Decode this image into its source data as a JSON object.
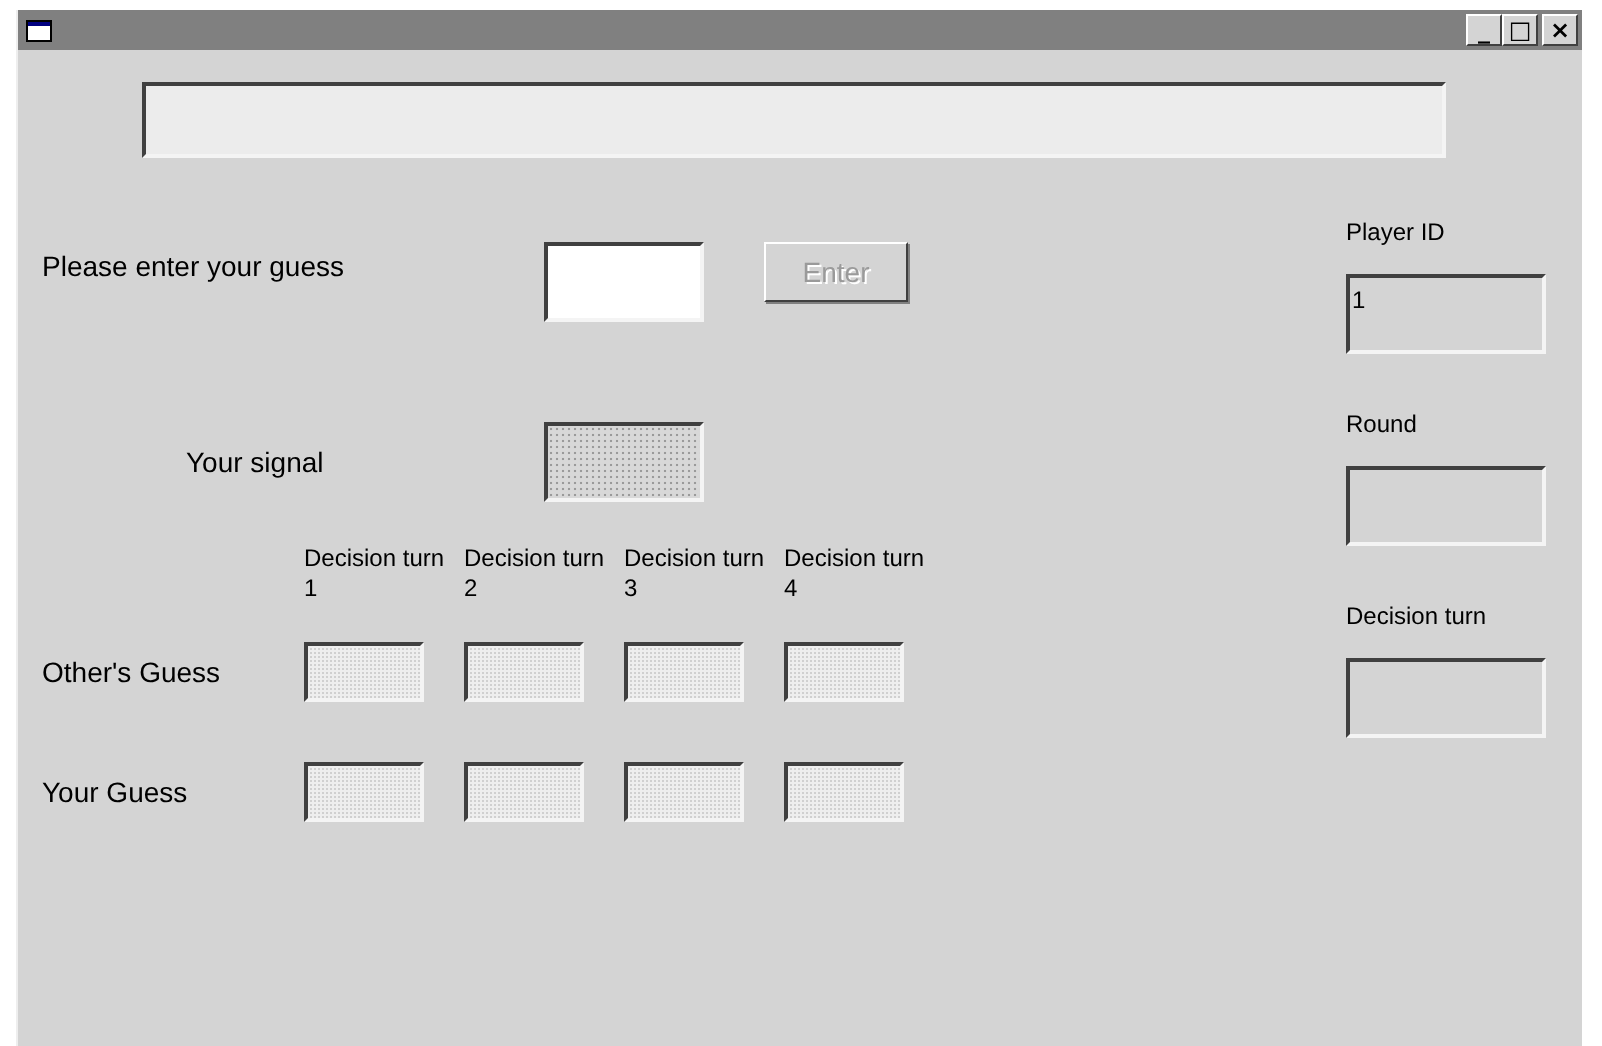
{
  "window": {
    "controls": [
      "_",
      "□",
      "×"
    ]
  },
  "status_display": {
    "disabled": true
  },
  "guess_prompt": {
    "label": "Please enter your guess",
    "disabled": false
  },
  "enter_button": {
    "label": "Enter",
    "disabled": true
  },
  "signal": {
    "label": "Your signal",
    "disabled": true
  },
  "columns": [
    "Decision turn 1",
    "Decision turn 2",
    "Decision turn 3",
    "Decision turn 4"
  ],
  "rows": [
    {
      "label": "Other's Guess",
      "cells": [
        {
          "disabled": true
        },
        {
          "disabled": true
        },
        {
          "disabled": true
        },
        {
          "disabled": true
        }
      ]
    },
    {
      "label": "Your Guess",
      "cells": [
        {
          "disabled": true
        },
        {
          "disabled": true
        },
        {
          "disabled": true
        },
        {
          "disabled": true
        }
      ]
    }
  ],
  "info_fields": [
    {
      "label": "Player ID",
      "value": "1"
    },
    {
      "label": "Round"
    },
    {
      "label": "Decision turn"
    }
  ]
}
